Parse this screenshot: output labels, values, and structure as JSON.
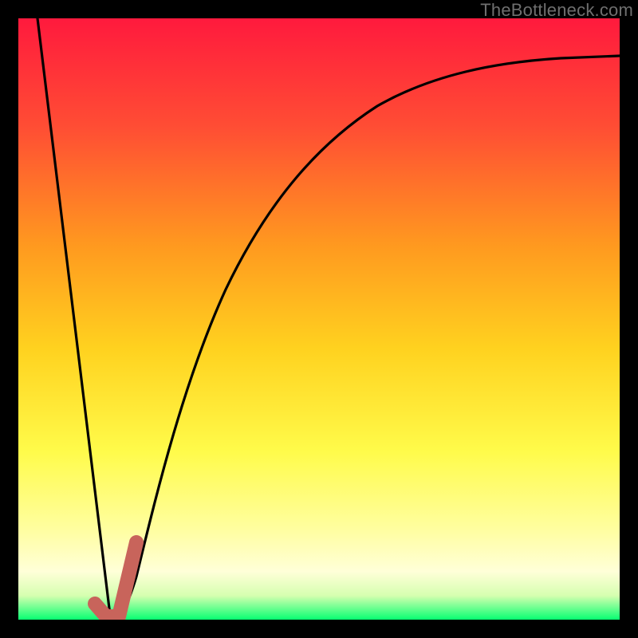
{
  "watermark": "TheBottleneck.com",
  "colors": {
    "frame": "#000000",
    "gradient_top": "#ff1a3d",
    "gradient_mid1": "#ff7a2a",
    "gradient_mid2": "#ffd21f",
    "gradient_mid3": "#fffb8a",
    "gradient_lower": "#ffffd0",
    "gradient_bottom": "#08ff72",
    "curve": "#000000",
    "marker": "#c8645b"
  },
  "chart_data": {
    "type": "line",
    "title": "",
    "xlabel": "",
    "ylabel": "",
    "xlim": [
      0,
      100
    ],
    "ylim": [
      0,
      100
    ],
    "series": [
      {
        "name": "bottleneck-curve",
        "x": [
          0,
          5,
          10,
          14,
          16,
          18,
          20,
          25,
          30,
          35,
          40,
          50,
          60,
          70,
          80,
          90,
          100
        ],
        "values": [
          100,
          65,
          30,
          3,
          0,
          3,
          12,
          34,
          48,
          58,
          65,
          75,
          81,
          85,
          88,
          90,
          91
        ]
      }
    ],
    "marker": {
      "name": "highlighted-segment",
      "x": [
        12.5,
        14,
        16,
        17,
        18,
        19
      ],
      "values": [
        2,
        0,
        0,
        3,
        8,
        13
      ]
    },
    "gradient_meaning": "vertical background maps bottleneck severity: top=red (bad), bottom=green (good)"
  }
}
